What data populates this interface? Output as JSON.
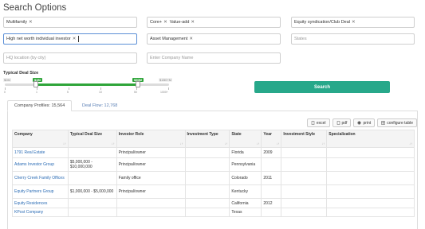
{
  "page": {
    "title": "Search Options"
  },
  "filters": {
    "property_types": [
      "Multifamily"
    ],
    "strategies": [
      "Core+",
      "Value-add"
    ],
    "deal_types": [
      "Equity syndication/Club Deal"
    ],
    "investor_types": [
      "High net worth individual investor"
    ],
    "asset_classes": [
      "Asset Management"
    ],
    "states_placeholder": "States",
    "hq_location_placeholder": "HQ location (by city)",
    "company_name_placeholder": "Enter Company Name"
  },
  "deal_size": {
    "label": "Typical Deal Size",
    "min_label": "$0M",
    "low_label": "$1M",
    "high_label": "$50M",
    "max_label": "$1B0+M",
    "low_value_m": 1,
    "high_value_m": 50,
    "tick_labels": [
      "0",
      "1",
      "5",
      "10",
      "50",
      "100",
      "1000+"
    ]
  },
  "search_button": "Search",
  "tabs": [
    {
      "label": "Company Profiles: 15,564",
      "active": true
    },
    {
      "label": "Deal Flow: 12,768",
      "active": false
    }
  ],
  "toolbar": {
    "excel": "excel",
    "pdf": "pdf",
    "print": "print",
    "configure": "configure table"
  },
  "table": {
    "headers": [
      "Company",
      "Typical Deal Size",
      "Investor Role",
      "Investment Type",
      "State",
      "Year",
      "Investment Style",
      "Specialization"
    ],
    "rows": [
      [
        "1791 Real Estate",
        "",
        "Principal/owner",
        "",
        "Florida",
        "2009",
        "",
        ""
      ],
      [
        "Adams Investor Group",
        "$5,000,000 - $10,000,000",
        "Principal/owner",
        "",
        "Pennsylvania",
        "",
        "",
        ""
      ],
      [
        "Cherry Creek Family Offices",
        "",
        "Family office",
        "",
        "Colorado",
        "2011",
        "",
        ""
      ],
      [
        "Equity Partners Group",
        "$1,000,000 - $5,000,000",
        "Principal/owner",
        "",
        "Kentucky",
        "",
        "",
        ""
      ],
      [
        "Equity Residences",
        "",
        "",
        "",
        "California",
        "2012",
        "",
        ""
      ],
      [
        "KPost Company",
        "",
        "",
        "",
        "Texas",
        "",
        "",
        ""
      ]
    ]
  },
  "colors": {
    "accent": "#27a88a",
    "slider": "#2fa53a",
    "link": "#2b6cb5"
  }
}
